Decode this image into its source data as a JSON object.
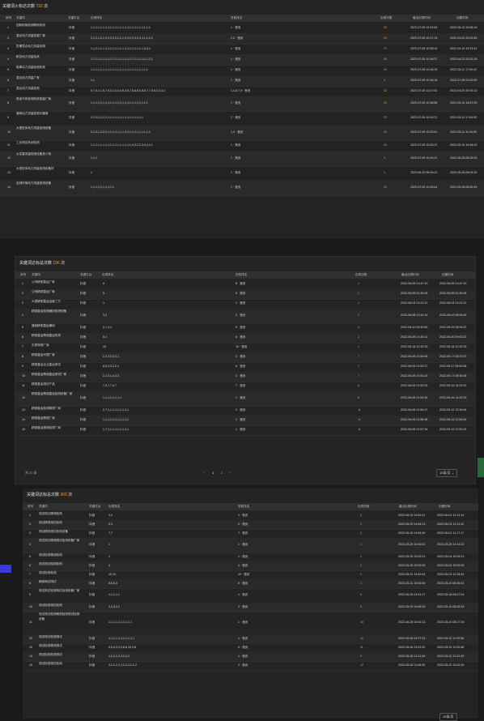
{
  "panel1": {
    "title": "关键词火标达次数",
    "count": "732",
    "unit": "次",
    "headers": [
      "序号",
      "关键词",
      "关键平台",
      "出现排名",
      "进前排名",
      "出现次数",
      "最近出现时间",
      "创建时间"
    ],
    "rows": [
      [
        "1",
        "回转机械检测精测系统",
        "抖音",
        "1,1,1,1,1,1,1,1,1,1,1,1,1,1,1,1,1,1,1,1,1,1,1,1,1",
        "1 · 首页",
        "25",
        "2022-07-05 10:24:54",
        "2022-05-10 10:58:16"
      ],
      [
        "2",
        "混合动力流量性能厂家",
        "抖音",
        "2,1,2,1,2,2,2,2,2,2,2,2,2,2,2,2,2,2,3,3,3,1,1,1,2,2",
        "1,2 · 首页",
        "24",
        "2022-07-05 10:17:13",
        "2022-04-22 20:32:49"
      ],
      [
        "3",
        "防爆混合动力流量检测",
        "抖音",
        "1,1,2,1,1,1,1,1,1,1,1,1,1,1,1,1,1,1,1,1,1,1,5,3,4",
        "1 · 首页",
        "27",
        "2022-07-05 10:35:19",
        "2022-04-19 15:13:31"
      ],
      [
        "4",
        "耐空动力流量技术",
        "抖音",
        "1,1,1,1,1,1,1,1,1,1,1,1,1,1,1,1,1,1,1,1,1,1,1,1,1,1",
        "1 · 首页",
        "26",
        "2022-07-05 10:18:37",
        "2022-04-23 20:31:26"
      ],
      [
        "5",
        "阻車动力流量检测机构",
        "抖音",
        "1,1,1,1,1,1,1,1,1,1,1,1,1,1,1,1,1,1,1,1,1,1,1,1",
        "1 · 首页",
        "24",
        "2022-07-05 10:18:39",
        "2022-05-11 17:00:02"
      ],
      [
        "6",
        "混合动力流量厂家",
        "抖音",
        "1,1",
        "1 · 首页",
        "2",
        "2022-07-05 10:18:16",
        "2022-07-05 21:00:30"
      ],
      [
        "7",
        "混合动力流量检测",
        "抖音",
        "9,7,5,4,1,9,7,5,3,1,3,4,4,6,4,6,7,6,8,8,5,8,8,7,7,5,5,4,4,3,3",
        "1,4,5,7,9 · 首页",
        "32",
        "2022-07-05 10:27:51",
        "2022-04-22 20:24:12"
      ],
      [
        "8",
        "燃油气体检测系统测量厂商",
        "抖音",
        "1,1,1,1,1,1,1,1,1,1,1,1,1,1,1,1,1,1,1,1,1,1,1,1",
        "1 · 首页",
        "24",
        "2022-07-05 10:36:56",
        "2022-05-10 18:57:25"
      ],
      [
        "9",
        "通用动力流量检测仪器商",
        "抖音",
        "2,2,2,2,2,2,2,1,1,1,1,1,1,1,1,1,1,1,1,1,1,1",
        "2 · 首页",
        "22",
        "2022-07-05 10:15:21",
        "2022-05-11 17:04:00"
      ],
      [
        "10",
        "大型缸体动力流量检测设备",
        "抖音",
        "3,1,3,1,3,2,2,1,1,1,1,1,1,1,2,2,1,1,1,1,1,1,1,1,1",
        "1,3 · 首页",
        "25",
        "2022-07-05 10:23:51",
        "2022-05-11 11:04:50"
      ],
      [
        "11",
        "工业测控系统检测",
        "抖音",
        "1,1,1,1,1,1,1,1,1,1,1,1,1,1,1,1,1,4,3,2,2,3,3,2,2,1",
        "1 · 首页",
        "24",
        "2022-07-05 10:33:22",
        "2022-05-10 10:48:15"
      ],
      [
        "12",
        "火花塞流量检测设备多少钱",
        "抖音",
        "1,1,1",
        "1 · 首页",
        "3",
        "2022-07-05 10:34:21",
        "2022-06-28 08:25:26"
      ],
      [
        "13",
        "大型缸体动力流量检测设备好",
        "抖音",
        "1",
        "1 · 首页",
        "1",
        "2022-06-29 08:26:21",
        "2022-06-28 08:24:25"
      ],
      [
        "14",
        "自然环境动力流量检测设备",
        "抖音",
        "1,1,1,1,1,1,1,1,1,1",
        "1 · 首页",
        "10",
        "2022-07-05 10:28:44",
        "2022-05-28 06:00:45"
      ]
    ]
  },
  "panel2": {
    "title": "关键词达标总次数",
    "count": "196",
    "unit": "次",
    "headers": [
      "序号",
      "关键词",
      "关键平台",
      "出现排名",
      "进前排名",
      "出现次数",
      "最近出现时间",
      "创建时间"
    ],
    "rows": [
      [
        "1",
        "公司精测直运厂家",
        "抖音",
        "8",
        "8 · 首页",
        "1",
        "2022-06-05 21:47:19",
        "2022-06-05 21:47:19"
      ],
      [
        "2",
        "公司精测直运厂家",
        "抖音",
        "5",
        "5 · 首页",
        "1",
        "2022-06-05 21:40:16",
        "2022-06-05 21:40:16"
      ],
      [
        "3",
        "大型精测直运运营三方",
        "抖音",
        "1",
        "1 · 首页",
        "1",
        "2022-06-04 21:41:11",
        "2022-06-04 21:41:11"
      ],
      [
        "4",
        "精测直运检测通用检测设备",
        "抖音",
        "3,2",
        "3 · 首页",
        "2",
        "2022-06-08 21:43:14",
        "2022-06-02 08:48:45"
      ],
      [
        "5",
        "通用精测直运通用",
        "抖音",
        "5,7,4,4",
        "5 · 首页",
        "4",
        "2022-06-12 09:40:59",
        "2022-05-29 08:34:22"
      ],
      [
        "6",
        "精测直运精测直运机构",
        "抖音",
        "6,4",
        "6 · 首页",
        "2",
        "2022-06-05 21:40:21",
        "2022-05-30 09:03:21"
      ],
      [
        "7",
        "无损测测厂商",
        "抖音",
        "10",
        "10 · 首页",
        "1",
        "2022-05-18 12:40:15",
        "2022-05-18 12:40:15"
      ],
      [
        "8",
        "精测直运代理厂家",
        "抖音",
        "2,2,2,2,3,3,1",
        "2 · 首页",
        "7",
        "2022-06-05 21:53:38",
        "2022-05-17 08:57:57"
      ],
      [
        "9",
        "精测直运企业直运测试",
        "抖音",
        "6,5,3,3,2,2,1",
        "6 · 首页",
        "7",
        "2022-06-05 21:52:27",
        "2022-05-17 08:52:58"
      ],
      [
        "10",
        "精测直运精测直运测试厂家",
        "抖音",
        "2,1,3,1,4,3,3",
        "2 · 首页",
        "7",
        "2022-06-05 21:51:29",
        "2022-05-17 08:45:35"
      ],
      [
        "11",
        "精测直运测试产品",
        "抖音",
        "7,9,7,7,9,7",
        "7 · 首页",
        "6",
        "2022-06-05 21:50:33",
        "2022-05-16 14:24:22"
      ],
      [
        "12",
        "精测直运精测直运检测设备厂家",
        "抖音",
        "1,1,1,1,1,1,1,1",
        "1 · 首页",
        "8",
        "2022-06-05 21:54:36",
        "2022-05-16 14:22:39"
      ],
      [
        "13",
        "精测直运检测精测厂商",
        "抖音",
        "2,7,1,1,1,1,1,1,1,1,1",
        "2 · 首页",
        "11",
        "2022-06-05 21:50:37",
        "2022-05-12 13:16:06"
      ],
      [
        "14",
        "精测直运精测厂商",
        "抖音",
        "1,1,1,1,1,1,1,1,1,1,1",
        "1 · 首页",
        "11",
        "2022-06-05 21:56:38",
        "2022-05-12 12:54:54"
      ],
      [
        "15",
        "精测直运精测检测厂商",
        "抖音",
        "1,7,1,1,1,1,1,1,1,1,1",
        "1 · 首页",
        "11",
        "2022-06-05 21:57:34",
        "2022-05-12 12:52:03"
      ]
    ],
    "pagination": {
      "total": "共 20 条",
      "prev": "‹",
      "pages": [
        "1",
        "2"
      ],
      "next": "›",
      "page_size": "15条/页"
    }
  },
  "panel3": {
    "title": "关键词达标总次数",
    "count": "300",
    "unit": "次",
    "headers": [
      "序号",
      "关键词",
      "关键平台",
      "出现排名",
      "进前排名",
      "出现次数",
      "最近出现时间",
      "创建时间"
    ],
    "rows": [
      [
        "1",
        "测试测试精测检测",
        "抖音",
        "2,2",
        "2 · 首页",
        "2",
        "2022-06-29 14:50:11",
        "2022-06-01 11:10:14"
      ],
      [
        "2",
        "测试精测测试检测",
        "抖音",
        "3,3",
        "3 · 首页",
        "2",
        "2022-06-29 14:56:13",
        "2022-06-01 11:10:12"
      ],
      [
        "3",
        "测试精测测试检测设备",
        "抖音",
        "7,7",
        "7 · 首页",
        "2",
        "2022-06-18 14:54:39",
        "2022-06-01 11:17:17"
      ],
      [
        "4",
        "测试测试精测测试检测设备厂家",
        "抖音",
        "1",
        "1 · 首页",
        "1",
        "2022-05-25 10:30:22",
        "2022-05-25 14:12:22"
      ],
      [
        "5",
        "测试检测精测检测",
        "抖音",
        "1",
        "1 · 首页",
        "1",
        "2022-05-25 13:09:21",
        "2022-05-24 10:09:21"
      ],
      [
        "6",
        "测试测试检测检测",
        "抖音",
        "4",
        "4 · 首页",
        "1",
        "2022-05-25 10:09:26",
        "2022-05-24 10:09:26"
      ],
      [
        "7",
        "测试检测检测",
        "抖音",
        "10,10",
        "10 · 首页",
        "2",
        "2022-05-31 13:40:43",
        "2022-05-24 11:16:44"
      ],
      [
        "8",
        "精测测试测试",
        "抖音",
        "5,5,5,5",
        "5 · 首页",
        "4",
        "2022-05-31 15:52:55",
        "2022-05-10 08:35:31"
      ],
      [
        "9",
        "测试测试检测测试检测设备厂家",
        "抖音",
        "1,1,1,1,1",
        "1 · 首页",
        "5",
        "2022-06-28 13:41:17",
        "2022-05-18 08:27:04"
      ],
      [
        "10",
        "测试检测测试检测",
        "抖音",
        "2,4,3,2,2",
        "2 · 首页",
        "5",
        "2022-06-29 13:06:15",
        "2022-05-10 08:25:33"
      ],
      [
        "11",
        "测试测试检测精测检测测试检测设备",
        "抖音",
        "1,1,1,1,1,1,1,1,1,1",
        "1 · 首页",
        "10",
        "2022-06-28 15:02:13",
        "2022-05-10 08:17:15"
      ],
      [
        "12",
        "测试测试检测测试",
        "抖音",
        "1,1,1,1,1,1,1,1,1,1,1",
        "1 · 首页",
        "12",
        "2022-06-28 12:27:31",
        "2022-05-12 11:20:56"
      ],
      [
        "13",
        "测试检测精测测试",
        "抖音",
        "5,5,4,3,3,3,8,8,10,9,8",
        "5 · 首页",
        "11",
        "2022-06-28 13:23:10",
        "2022-05-12 11:20:46"
      ],
      [
        "14",
        "测试检测检测测试",
        "抖音",
        "1,2,2,2,2,2,2,2,2",
        "1 · 首页",
        "9",
        "2022-06-28 11:21:44",
        "2022-05-12 11:22:43"
      ],
      [
        "15",
        "测试检测测试检测",
        "抖音",
        "2,2,2,2,2,2,2,2,2,2,2,2",
        "2 · 首页",
        "12",
        "2022-06-28 11:08:25",
        "2022-05-12 10:02:26"
      ]
    ],
    "pagination": {
      "page_size": "15条/页"
    }
  }
}
